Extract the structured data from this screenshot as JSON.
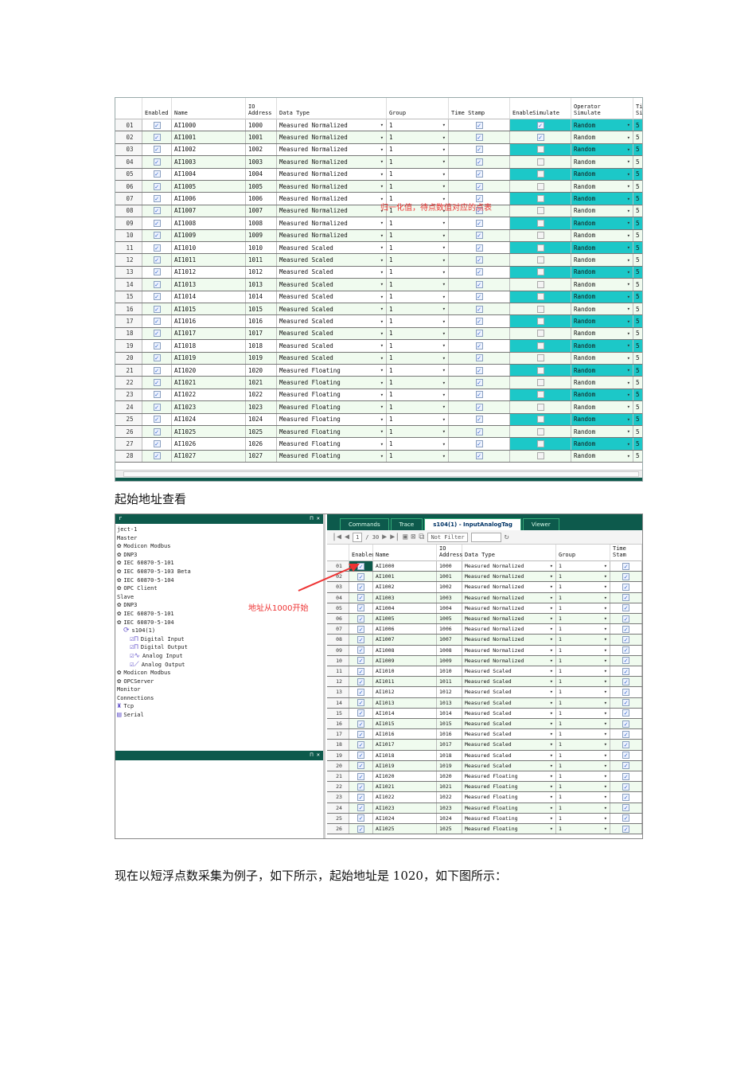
{
  "table1": {
    "headers": [
      "",
      "Enabled",
      "Name",
      "IO Address",
      "Data Type",
      "Group",
      "Time Stamp",
      "EnableSimulate",
      "Operator Simulate",
      "Ti Si"
    ],
    "rows": [
      {
        "no": "01",
        "name": "AI1000",
        "addr": "1000",
        "type": "Measured Normalized",
        "group": "1",
        "sim": true,
        "op": "Random",
        "last": "5"
      },
      {
        "no": "02",
        "name": "AI1001",
        "addr": "1001",
        "type": "Measured Normalized",
        "group": "1",
        "sim": true,
        "op": "Random",
        "last": "5"
      },
      {
        "no": "03",
        "name": "AI1002",
        "addr": "1002",
        "type": "Measured Normalized",
        "group": "1",
        "sim": false,
        "op": "Random",
        "last": "5"
      },
      {
        "no": "04",
        "name": "AI1003",
        "addr": "1003",
        "type": "Measured Normalized",
        "group": "1",
        "sim": false,
        "op": "Random",
        "last": "5"
      },
      {
        "no": "05",
        "name": "AI1004",
        "addr": "1004",
        "type": "Measured Normalized",
        "group": "1",
        "sim": false,
        "op": "Random",
        "last": "5"
      },
      {
        "no": "06",
        "name": "AI1005",
        "addr": "1005",
        "type": "Measured Normalized",
        "group": "1",
        "sim": false,
        "op": "Random",
        "last": "5"
      },
      {
        "no": "07",
        "name": "AI1006",
        "addr": "1006",
        "type": "Measured Normalized",
        "group": "1",
        "sim": false,
        "op": "Random",
        "last": "5"
      },
      {
        "no": "08",
        "name": "AI1007",
        "addr": "1007",
        "type": "Measured Normalized",
        "group": "1",
        "sim": false,
        "op": "Random",
        "last": "5"
      },
      {
        "no": "09",
        "name": "AI1008",
        "addr": "1008",
        "type": "Measured Normalized",
        "group": "1",
        "sim": false,
        "op": "Random",
        "last": "5"
      },
      {
        "no": "10",
        "name": "AI1009",
        "addr": "1009",
        "type": "Measured Normalized",
        "group": "1",
        "sim": false,
        "op": "Random",
        "last": "5"
      },
      {
        "no": "11",
        "name": "AI1010",
        "addr": "1010",
        "type": "Measured Scaled",
        "group": "1",
        "sim": false,
        "op": "Random",
        "last": "5"
      },
      {
        "no": "12",
        "name": "AI1011",
        "addr": "1011",
        "type": "Measured Scaled",
        "group": "1",
        "sim": false,
        "op": "Random",
        "last": "5"
      },
      {
        "no": "13",
        "name": "AI1012",
        "addr": "1012",
        "type": "Measured Scaled",
        "group": "1",
        "sim": false,
        "op": "Random",
        "last": "5"
      },
      {
        "no": "14",
        "name": "AI1013",
        "addr": "1013",
        "type": "Measured Scaled",
        "group": "1",
        "sim": false,
        "op": "Random",
        "last": "5"
      },
      {
        "no": "15",
        "name": "AI1014",
        "addr": "1014",
        "type": "Measured Scaled",
        "group": "1",
        "sim": false,
        "op": "Random",
        "last": "5"
      },
      {
        "no": "16",
        "name": "AI1015",
        "addr": "1015",
        "type": "Measured Scaled",
        "group": "1",
        "sim": false,
        "op": "Random",
        "last": "5"
      },
      {
        "no": "17",
        "name": "AI1016",
        "addr": "1016",
        "type": "Measured Scaled",
        "group": "1",
        "sim": false,
        "op": "Random",
        "last": "5"
      },
      {
        "no": "18",
        "name": "AI1017",
        "addr": "1017",
        "type": "Measured Scaled",
        "group": "1",
        "sim": false,
        "op": "Random",
        "last": "5"
      },
      {
        "no": "19",
        "name": "AI1018",
        "addr": "1018",
        "type": "Measured Scaled",
        "group": "1",
        "sim": false,
        "op": "Random",
        "last": "5"
      },
      {
        "no": "20",
        "name": "AI1019",
        "addr": "1019",
        "type": "Measured Scaled",
        "group": "1",
        "sim": false,
        "op": "Random",
        "last": "5"
      },
      {
        "no": "21",
        "name": "AI1020",
        "addr": "1020",
        "type": "Measured Floating",
        "group": "1",
        "sim": false,
        "op": "Random",
        "last": "5"
      },
      {
        "no": "22",
        "name": "AI1021",
        "addr": "1021",
        "type": "Measured Floating",
        "group": "1",
        "sim": false,
        "op": "Random",
        "last": "5"
      },
      {
        "no": "23",
        "name": "AI1022",
        "addr": "1022",
        "type": "Measured Floating",
        "group": "1",
        "sim": false,
        "op": "Random",
        "last": "5"
      },
      {
        "no": "24",
        "name": "AI1023",
        "addr": "1023",
        "type": "Measured Floating",
        "group": "1",
        "sim": false,
        "op": "Random",
        "last": "5"
      },
      {
        "no": "25",
        "name": "AI1024",
        "addr": "1024",
        "type": "Measured Floating",
        "group": "1",
        "sim": false,
        "op": "Random",
        "last": "5"
      },
      {
        "no": "26",
        "name": "AI1025",
        "addr": "1025",
        "type": "Measured Floating",
        "group": "1",
        "sim": false,
        "op": "Random",
        "last": "5"
      },
      {
        "no": "27",
        "name": "AI1026",
        "addr": "1026",
        "type": "Measured Floating",
        "group": "1",
        "sim": false,
        "op": "Random",
        "last": "5"
      },
      {
        "no": "28",
        "name": "AI1027",
        "addr": "1027",
        "type": "Measured Floating",
        "group": "1",
        "sim": false,
        "op": "Random",
        "last": "5"
      }
    ],
    "annotation": "归一化值，待点数值对应的点表"
  },
  "caption1": "起始地址查看",
  "shot2": {
    "explorer_title": "r",
    "tree": [
      {
        "label": "ject-1",
        "level": 0,
        "icon": ""
      },
      {
        "label": "Master",
        "level": 0,
        "icon": ""
      },
      {
        "label": "Modicon Modbus",
        "level": 0,
        "icon": "gear"
      },
      {
        "label": "DNP3",
        "level": 0,
        "icon": "gear"
      },
      {
        "label": "IEC 60870-5-101",
        "level": 0,
        "icon": "gear"
      },
      {
        "label": "IEC 60870-5-103 Beta",
        "level": 0,
        "icon": "gear"
      },
      {
        "label": "IEC 60870-5-104",
        "level": 0,
        "icon": "gear"
      },
      {
        "label": "OPC Client",
        "level": 0,
        "icon": "gear"
      },
      {
        "label": "Slave",
        "level": 0,
        "icon": ""
      },
      {
        "label": "DNP3",
        "level": 0,
        "icon": "gear"
      },
      {
        "label": "IEC 60870-5-101",
        "level": 0,
        "icon": "gear"
      },
      {
        "label": "IEC 60870-5-104",
        "level": 0,
        "icon": "gear"
      },
      {
        "label": "s104(1)",
        "level": 1,
        "icon": "refresh"
      },
      {
        "label": "Digital Input",
        "level": 2,
        "icon": "digital"
      },
      {
        "label": "Digital Output",
        "level": 2,
        "icon": "digital"
      },
      {
        "label": "Analog Input",
        "level": 2,
        "icon": "analog"
      },
      {
        "label": "Analog Output",
        "level": 2,
        "icon": "analog-out"
      },
      {
        "label": "Modicon Modbus",
        "level": 0,
        "icon": "gear"
      },
      {
        "label": "OPCServer",
        "level": 0,
        "icon": "gear"
      },
      {
        "label": "Monitor",
        "level": 0,
        "icon": ""
      },
      {
        "label": "Connections",
        "level": 0,
        "icon": ""
      },
      {
        "label": "Tcp",
        "level": 0,
        "icon": "tcp"
      },
      {
        "label": "Serial",
        "level": 0,
        "icon": "serial"
      }
    ],
    "tabs": [
      "Commands",
      "Trace",
      "s104(1) - InputAnalogTag",
      "Viewer"
    ],
    "active_tab": 2,
    "toolbar": {
      "page": "1",
      "page_total": "/ 30",
      "filter": "Not Filter"
    },
    "headers": [
      "",
      "Enabled",
      "Name",
      "IO Address",
      "Data Type",
      "Group",
      "Time Stam"
    ],
    "row_count": 26,
    "annotation": "地址从1000开始"
  },
  "paragraph": "现在以短浮点数采集为例子，如下所示，起始地址是 1020，如下图所示："
}
